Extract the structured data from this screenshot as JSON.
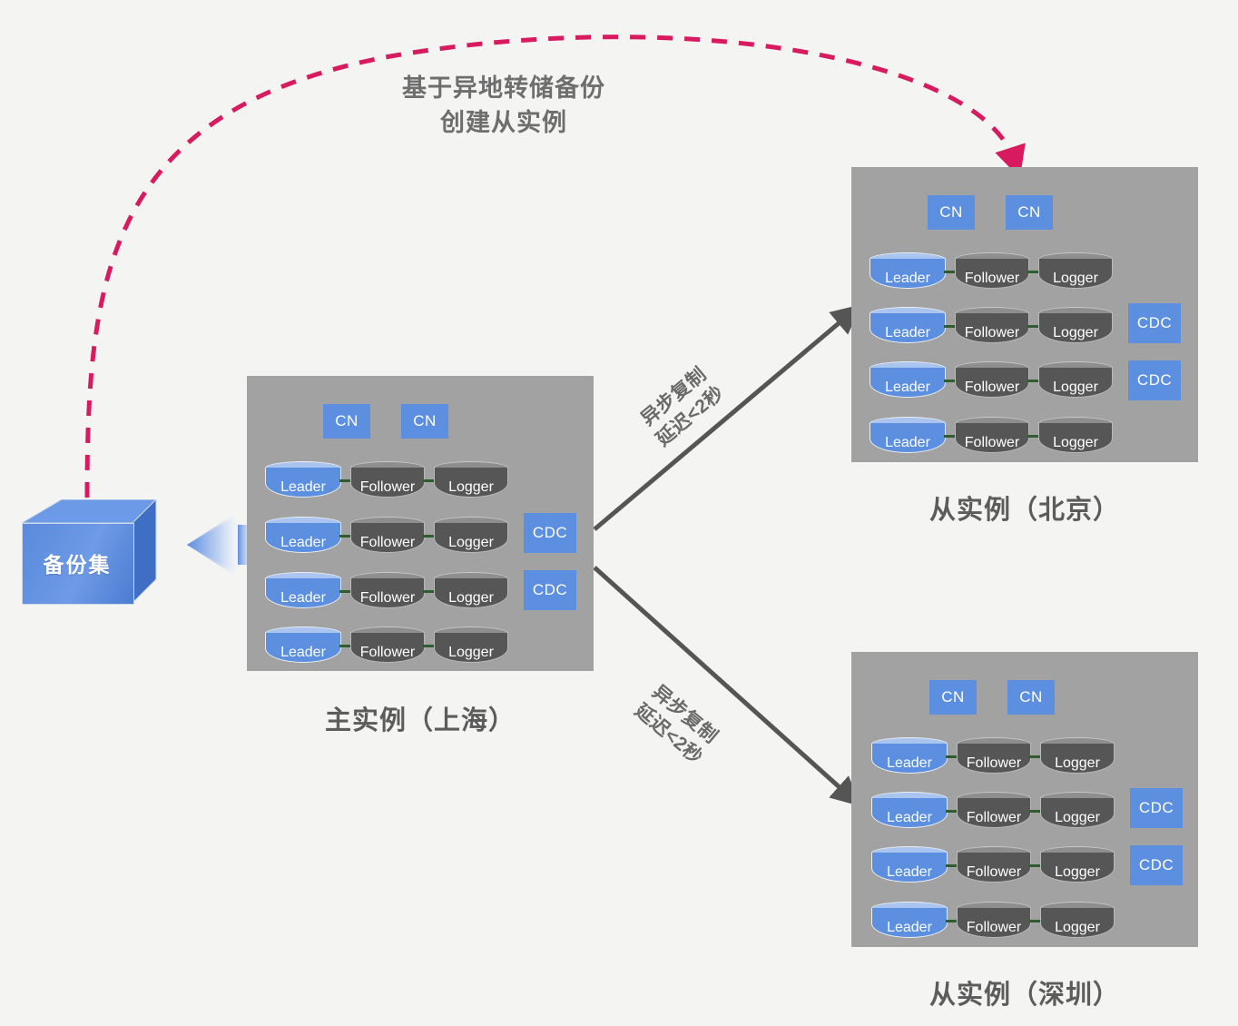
{
  "headline": {
    "text": "基于异地转储备份\n创建从实例",
    "color": "#6e6e6e"
  },
  "backup": {
    "label": "备份集",
    "color": "#5a8ade"
  },
  "edges": {
    "restore_arrow": "dashed-pink-arrow",
    "ingest_arrow": "left-block-arrow",
    "replication_top": "异步复制\n延迟<2秒",
    "replication_bottom": "异步复制\n延迟<2秒",
    "colors": {
      "dashed": "#d81b60",
      "solid": "#555555",
      "connector": "#2f5d2f"
    }
  },
  "instances": [
    {
      "id": "primary-shanghai",
      "caption": "主实例（上海）",
      "cn": [
        "CN",
        "CN"
      ],
      "rows": [
        {
          "nodes": [
            "Leader",
            "Follower",
            "Logger"
          ],
          "cdc": null
        },
        {
          "nodes": [
            "Leader",
            "Follower",
            "Logger"
          ],
          "cdc": "CDC"
        },
        {
          "nodes": [
            "Leader",
            "Follower",
            "Logger"
          ],
          "cdc": "CDC"
        },
        {
          "nodes": [
            "Leader",
            "Follower",
            "Logger"
          ],
          "cdc": null
        }
      ]
    },
    {
      "id": "replica-beijing",
      "caption": "从实例（北京）",
      "cn": [
        "CN",
        "CN"
      ],
      "rows": [
        {
          "nodes": [
            "Leader",
            "Follower",
            "Logger"
          ],
          "cdc": null
        },
        {
          "nodes": [
            "Leader",
            "Follower",
            "Logger"
          ],
          "cdc": "CDC"
        },
        {
          "nodes": [
            "Leader",
            "Follower",
            "Logger"
          ],
          "cdc": "CDC"
        },
        {
          "nodes": [
            "Leader",
            "Follower",
            "Logger"
          ],
          "cdc": null
        }
      ]
    },
    {
      "id": "replica-shenzhen",
      "caption": "从实例（深圳）",
      "cn": [
        "CN",
        "CN"
      ],
      "rows": [
        {
          "nodes": [
            "Leader",
            "Follower",
            "Logger"
          ],
          "cdc": null
        },
        {
          "nodes": [
            "Leader",
            "Follower",
            "Logger"
          ],
          "cdc": "CDC"
        },
        {
          "nodes": [
            "Leader",
            "Follower",
            "Logger"
          ],
          "cdc": "CDC"
        },
        {
          "nodes": [
            "Leader",
            "Follower",
            "Logger"
          ],
          "cdc": null
        }
      ]
    }
  ]
}
